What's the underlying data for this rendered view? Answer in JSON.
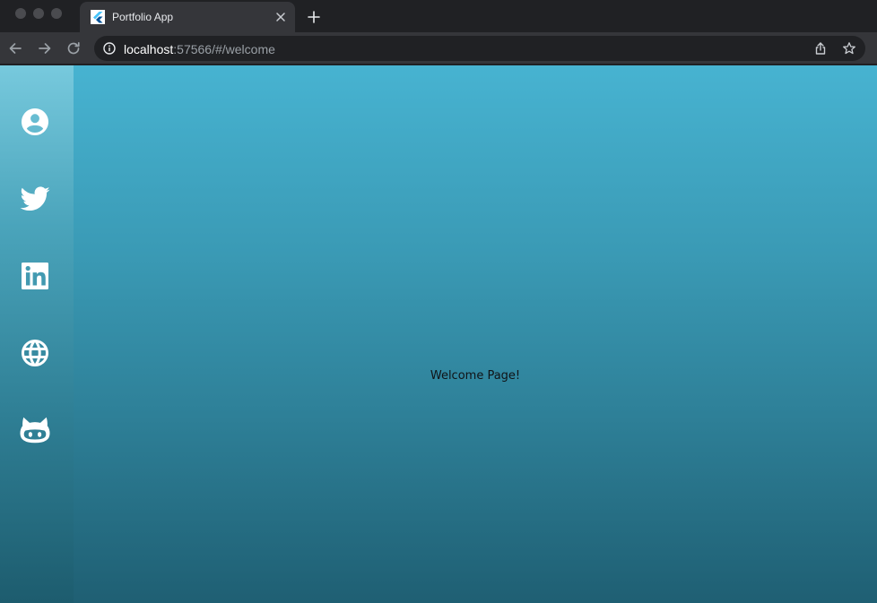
{
  "browser": {
    "tab_title": "Portfolio App",
    "url_host": "localhost",
    "url_rest": ":57566/#/welcome"
  },
  "sidebar": {
    "items": [
      {
        "icon": "account-circle-icon",
        "name": "profile"
      },
      {
        "icon": "twitter-icon",
        "name": "twitter"
      },
      {
        "icon": "linkedin-icon",
        "name": "linkedin"
      },
      {
        "icon": "globe-icon",
        "name": "website"
      },
      {
        "icon": "github-icon",
        "name": "github"
      }
    ]
  },
  "main": {
    "welcome_text": "Welcome Page!"
  },
  "colors": {
    "chrome_dark": "#202124",
    "chrome_tab": "#35363a",
    "gradient_top": "#47b3d1",
    "gradient_bottom": "#1f5f73",
    "icon": "#ffffff"
  }
}
